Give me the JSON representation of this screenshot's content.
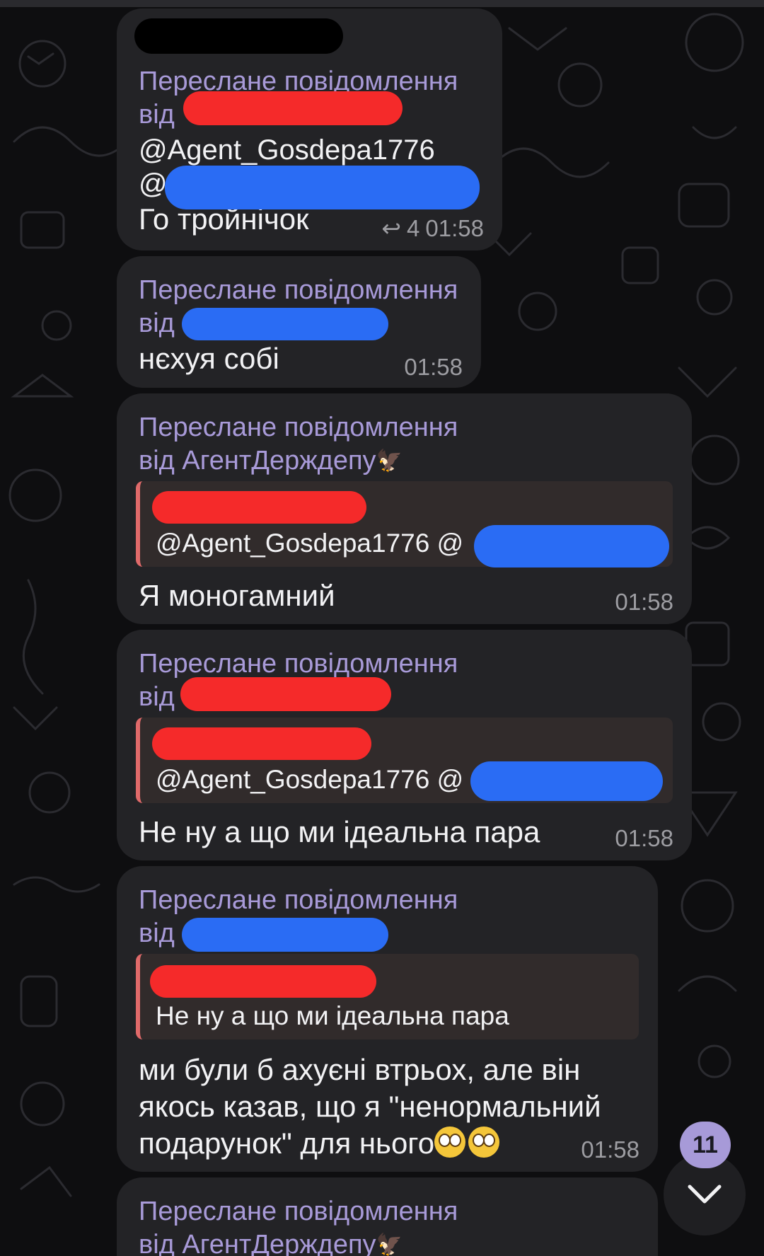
{
  "messages": [
    {
      "forward_label": "Переслане повідомлення",
      "forward_from": "від",
      "handle_line1": "@Agent_Gosdepa1776",
      "handle_line2": "@",
      "text": "Го тройнічок",
      "reply_count": "4",
      "time": "01:58"
    },
    {
      "forward_label": "Переслане повідомлення",
      "forward_from": "від",
      "text": "нєхуя собі",
      "time": "01:58"
    },
    {
      "forward_label": "Переслане повідомлення",
      "forward_from": "від АгентДерждепу",
      "quote_text": "@Agent_Gosdepa1776 @",
      "text": "Я моногамний",
      "time": "01:58"
    },
    {
      "forward_label": "Переслане повідомлення",
      "forward_from": "від",
      "quote_text": "@Agent_Gosdepa1776 @",
      "text": "Не ну а що ми ідеальна пара",
      "time": "01:58"
    },
    {
      "forward_label": "Переслане повідомлення",
      "forward_from": "від",
      "quote_text": "Не ну а що ми ідеальна пара",
      "text_line1": "ми були б ахуєні втрьох, але він",
      "text_line2": "якось казав, що я \"ненормальний",
      "text_line3": "подарунок\" для нього",
      "time": "01:58"
    },
    {
      "forward_label": "Переслане повідомлення",
      "forward_from": "від АгентДерждепу"
    }
  ],
  "unread_badge": "11",
  "icons": {
    "reply": "reply-arrow-icon",
    "eagle": "eagle-emoji-icon",
    "eye_roll": "face-with-rolling-eyes-icon",
    "scroll_down": "chevron-down-icon"
  },
  "colors": {
    "background": "#0e0e10",
    "bubble": "#232326",
    "forward_label": "#a89ad8",
    "quote_bar": "#e06a6a",
    "badge": "#a79ad8",
    "redaction_red": "#f52a2a",
    "redaction_blue": "#2a6cf4"
  }
}
